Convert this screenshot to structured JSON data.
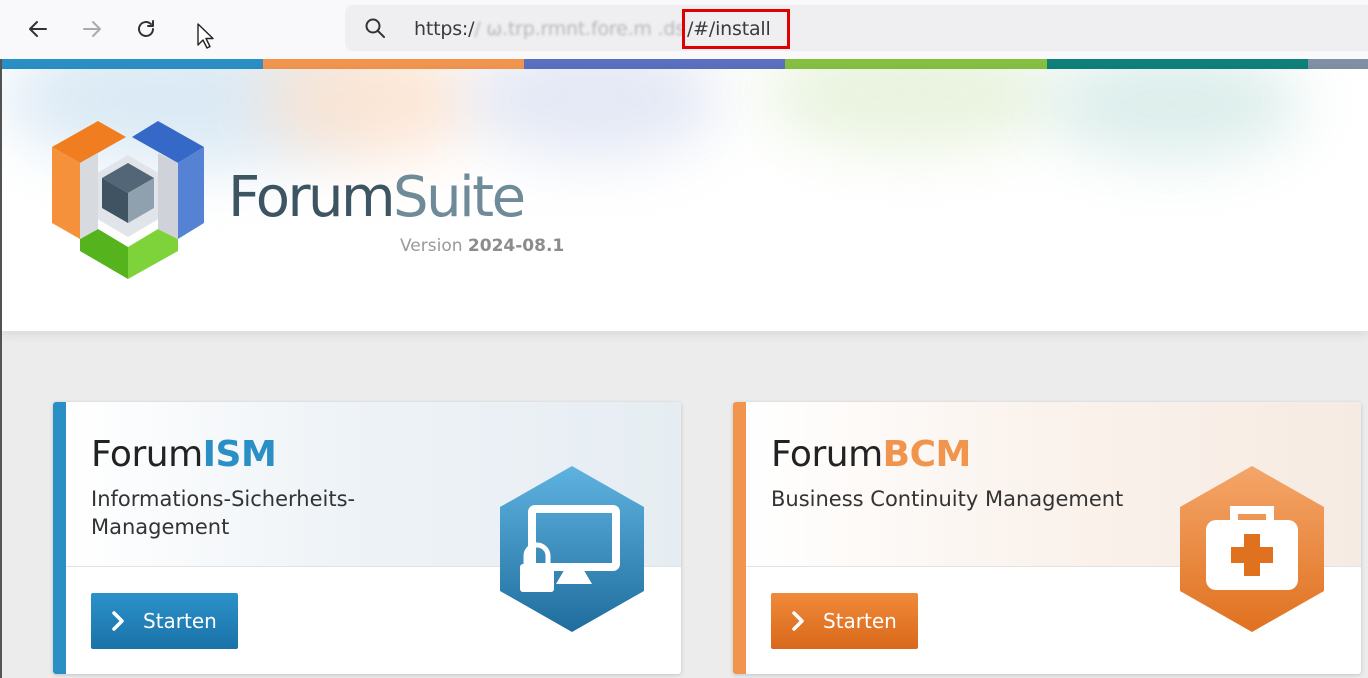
{
  "browser": {
    "url_prefix": "https:/",
    "url_obscured": "/ ω.trp.rmnt.fore.m .ds",
    "url_fragment": "/#/install",
    "icons": [
      "back-arrow-icon",
      "forward-arrow-icon",
      "reload-icon",
      "search-icon",
      "mouse-cursor-icon"
    ]
  },
  "stripe_colors": [
    "#2a8fc4",
    "#f0944e",
    "#5a6fbf",
    "#84bf41",
    "#0f8079",
    "#7f8fa4"
  ],
  "header": {
    "brand_part1": "Forum",
    "brand_part2": "Suite",
    "version_label": "Version",
    "version_number": "2024-08.1"
  },
  "cards": [
    {
      "title_prefix": "Forum",
      "title_suffix": "ISM",
      "subtitle": "Informations-Sicherheits-Management",
      "button_label": "Starten",
      "accent": "#2a8fc4",
      "icon": "computer-lock-icon"
    },
    {
      "title_prefix": "Forum",
      "title_suffix": "BCM",
      "subtitle": "Business Continuity Management",
      "button_label": "Starten",
      "accent": "#f0944e",
      "icon": "first-aid-kit-icon"
    }
  ]
}
